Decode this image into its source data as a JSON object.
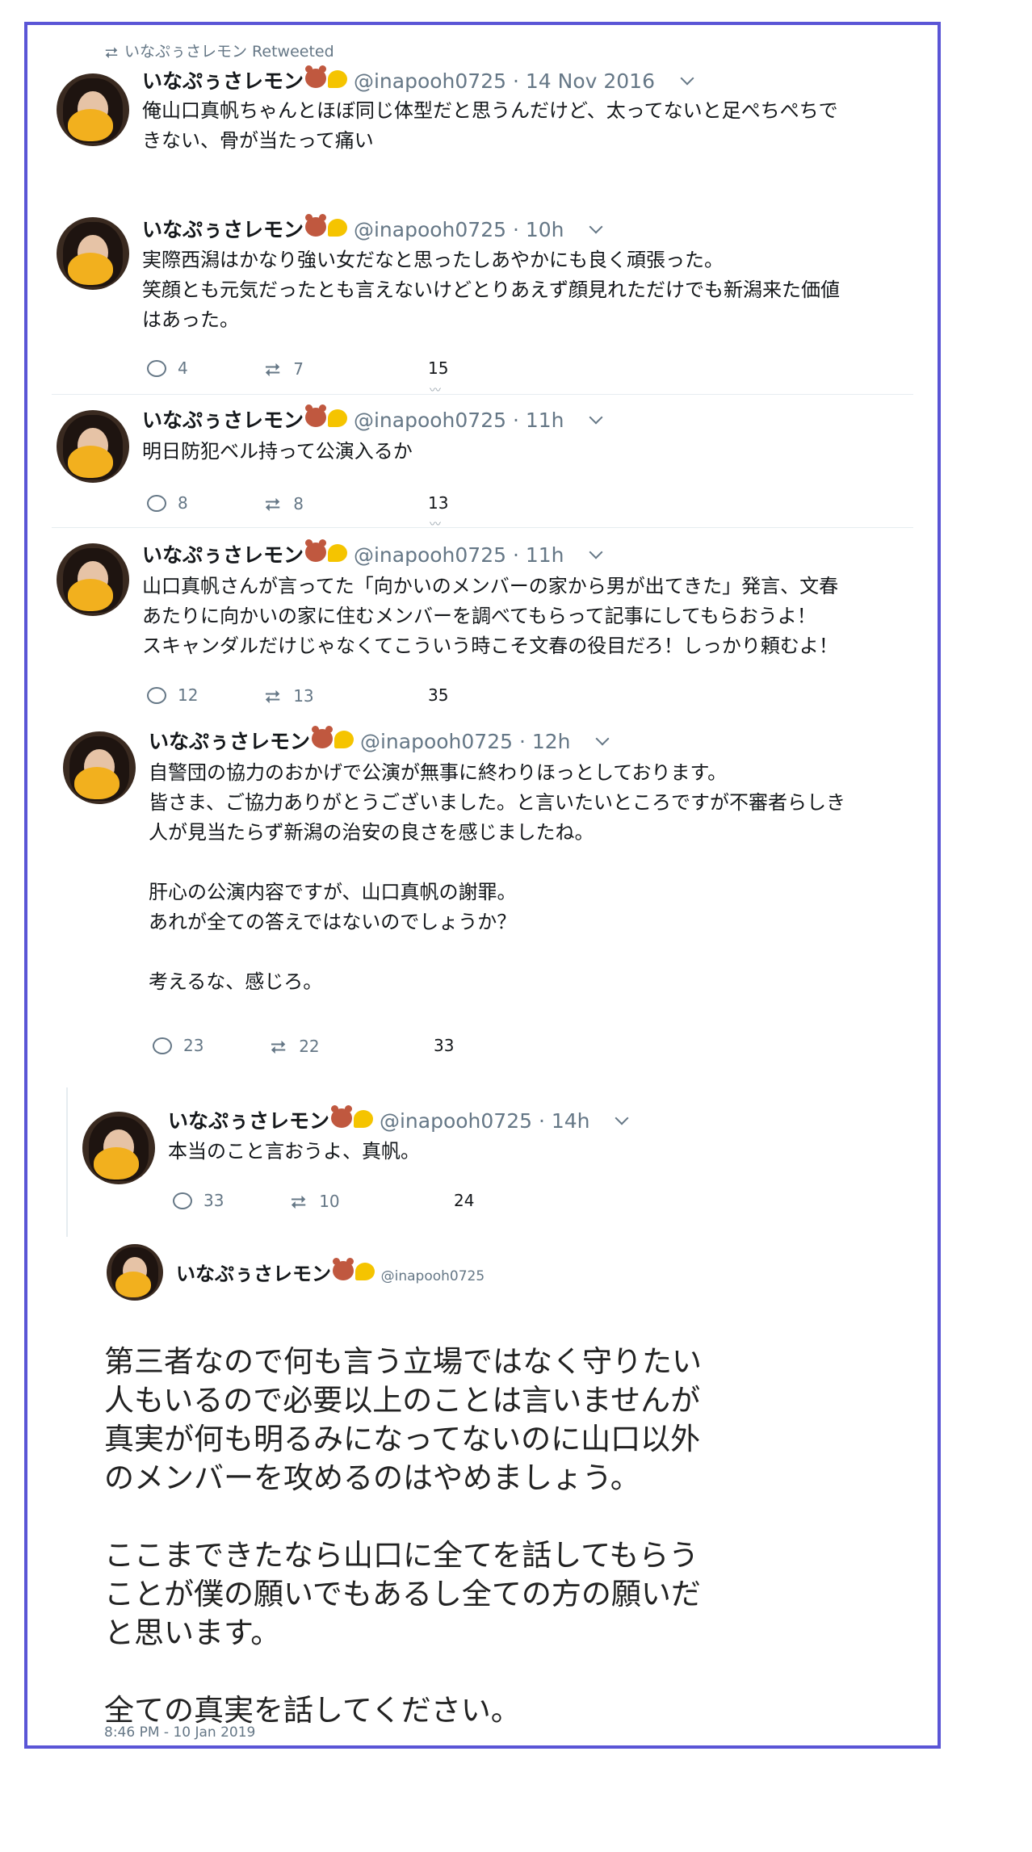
{
  "retweet_label": "いなぷぅさレモン Retweeted",
  "tweets": [
    {
      "name": "いなぷぅさレモン",
      "handle": "@inapooh0725",
      "time": "· 14 Nov 2016",
      "text": "俺山口真帆ちゃんとほぼ同じ体型だと思うんだけど、太ってないと足ぺちぺちで\nきない、骨が当たって痛い"
    },
    {
      "name": "いなぷぅさレモン",
      "handle": "@inapooh0725",
      "time": "· 10h",
      "text": "実際西潟はかなり強い女だなと思ったしあやかにも良く頑張った。\n笑顔とも元気だったとも言えないけどとりあえず顔見れただけでも新潟来た価値\nはあった。",
      "replies": "4",
      "retweets": "7",
      "likes": "15"
    },
    {
      "name": "いなぷぅさレモン",
      "handle": "@inapooh0725",
      "time": "· 11h",
      "text": "明日防犯ベル持って公演入るか",
      "replies": "8",
      "retweets": "8",
      "likes": "13"
    },
    {
      "name": "いなぷぅさレモン",
      "handle": "@inapooh0725",
      "time": "· 11h",
      "text": "山口真帆さんが言ってた「向かいのメンバーの家から男が出てきた」発言、文春\nあたりに向かいの家に住むメンバーを調べてもらって記事にしてもらおうよ！\nスキャンダルだけじゃなくてこういう時こそ文春の役目だろ！しっかり頼むよ！",
      "replies": "12",
      "retweets": "13",
      "likes": "35"
    },
    {
      "name": "いなぷぅさレモン",
      "handle": "@inapooh0725",
      "time": "· 12h",
      "text": "自警団の協力のおかげで公演が無事に終わりほっとしております。\n皆さま、ご協力ありがとうございました。と言いたいところですが不審者らしき\n人が見当たらず新潟の治安の良さを感じましたね。\n\n肝心の公演内容ですが、山口真帆の謝罪。\nあれが全ての答えではないのでしょうか？\n\n考えるな、感じろ。",
      "replies": "23",
      "retweets": "22",
      "likes": "33"
    },
    {
      "name": "いなぷぅさレモン",
      "handle": "@inapooh0725",
      "time": "· 14h",
      "text": "本当のこと言おうよ、真帆。",
      "replies": "33",
      "retweets": "10",
      "likes": "24"
    }
  ],
  "final": {
    "name": "いなぷぅさレモン",
    "handle": "@inapooh0725",
    "text": "第三者なので何も言う立場ではなく守りたい\n人もいるので必要以上のことは言いませんが\n真実が何も明るみになってないのに山口以外\nのメンバーを攻めるのはやめましょう。\n\nここまできたなら山口に全てを話してもらう\nことが僕の願いでもあるし全ての方の願いだ\nと思います。\n\n全ての真実を話してください。",
    "timestamp": "8:46 PM - 10 Jan 2019"
  },
  "colors": {
    "frame": "#5a55d6",
    "muted": "#657786",
    "text": "#14171a"
  },
  "icons": [
    "retweet-icon",
    "reply-icon",
    "chevron-down-icon",
    "bear-emoji",
    "lemon-emoji"
  ]
}
